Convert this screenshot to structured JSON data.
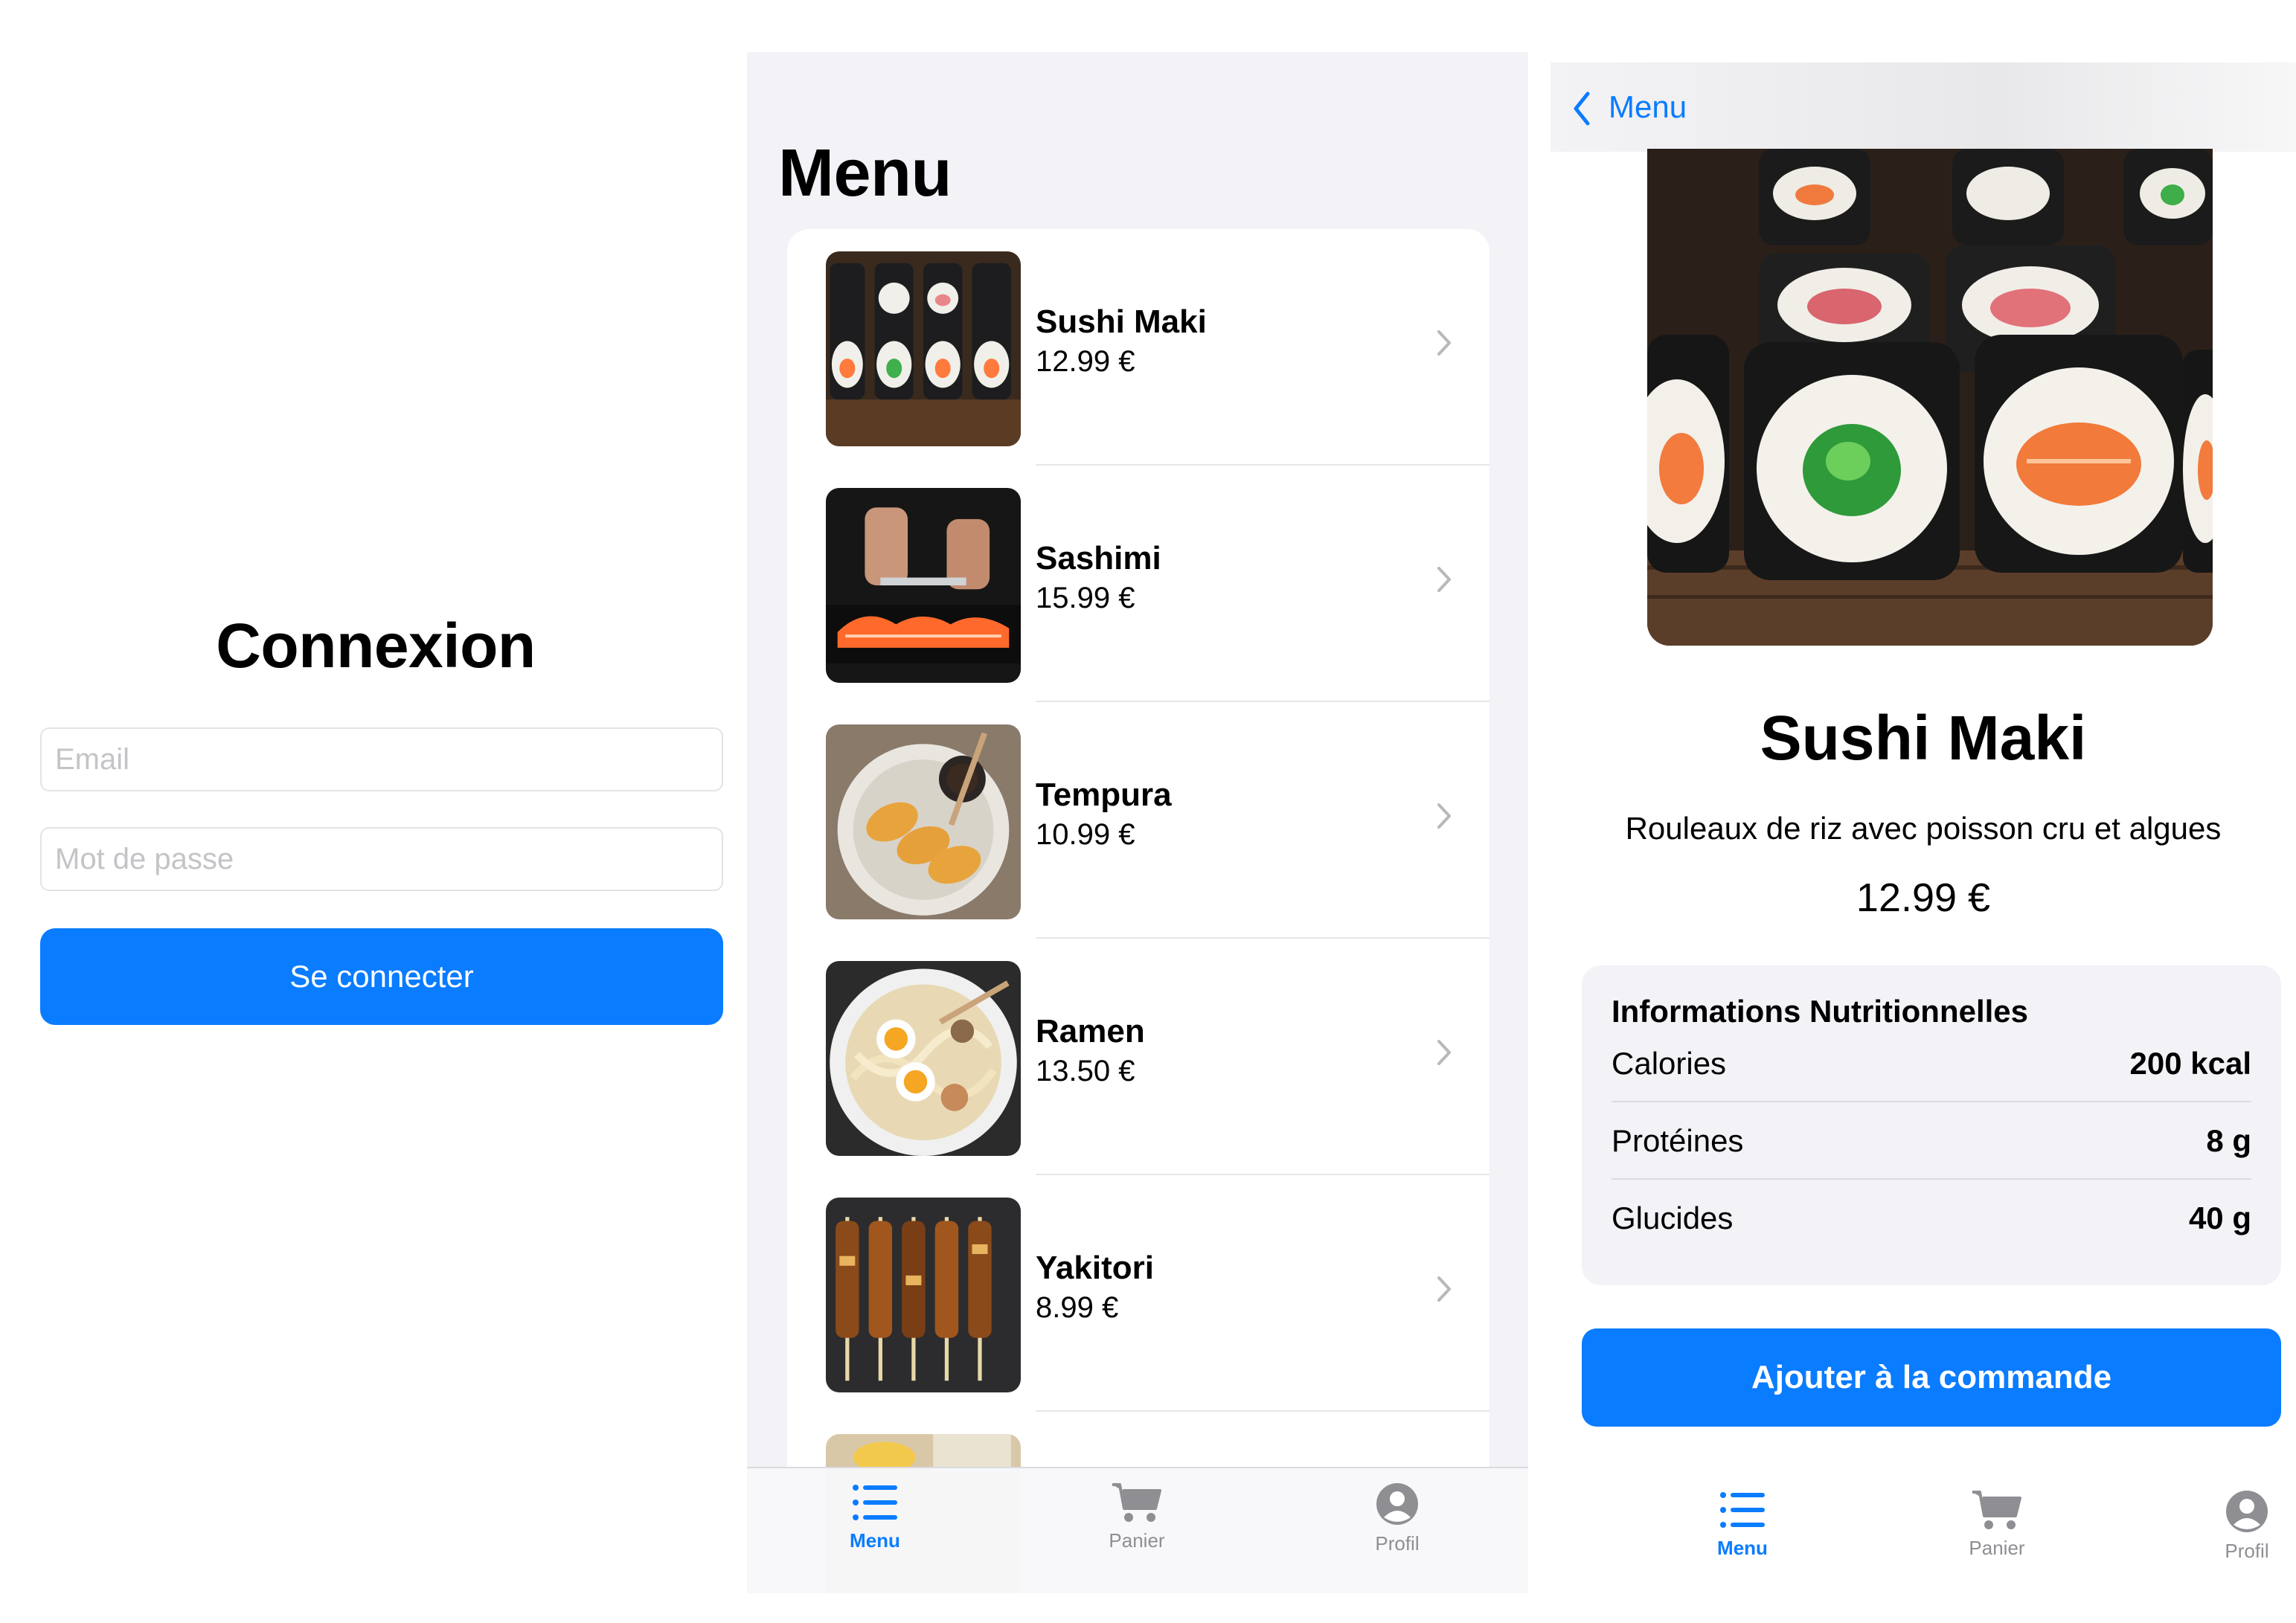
{
  "login": {
    "title": "Connexion",
    "email_placeholder": "Email",
    "email_value": "",
    "password_placeholder": "Mot de passe",
    "password_value": "",
    "submit_label": "Se connecter"
  },
  "menu": {
    "title": "Menu",
    "items": [
      {
        "name": "Sushi Maki",
        "price": "12.99 €",
        "image": "sushi-maki-photo"
      },
      {
        "name": "Sashimi",
        "price": "15.99 €",
        "image": "sashimi-photo"
      },
      {
        "name": "Tempura",
        "price": "10.99 €",
        "image": "tempura-photo"
      },
      {
        "name": "Ramen",
        "price": "13.50 €",
        "image": "ramen-photo"
      },
      {
        "name": "Yakitori",
        "price": "8.99 €",
        "image": "yakitori-photo"
      }
    ]
  },
  "tabs": [
    {
      "label": "Menu",
      "icon": "list-icon",
      "active": true
    },
    {
      "label": "Panier",
      "icon": "cart-icon",
      "active": false
    },
    {
      "label": "Profil",
      "icon": "person-circle-icon",
      "active": false
    }
  ],
  "detail": {
    "back_label": "Menu",
    "name": "Sushi Maki",
    "description": "Rouleaux de riz avec poisson cru et algues",
    "price": "12.99 €",
    "nutrition": {
      "title": "Informations Nutritionnelles",
      "rows": [
        {
          "label": "Calories",
          "value": "200 kcal"
        },
        {
          "label": "Protéines",
          "value": "8 g"
        },
        {
          "label": "Glucides",
          "value": "40 g"
        }
      ]
    },
    "add_label": "Ajouter à la commande"
  },
  "colors": {
    "accent": "#0a7cff",
    "grouped_background": "#f2f2f7",
    "secondary_text": "#8e8e93"
  }
}
